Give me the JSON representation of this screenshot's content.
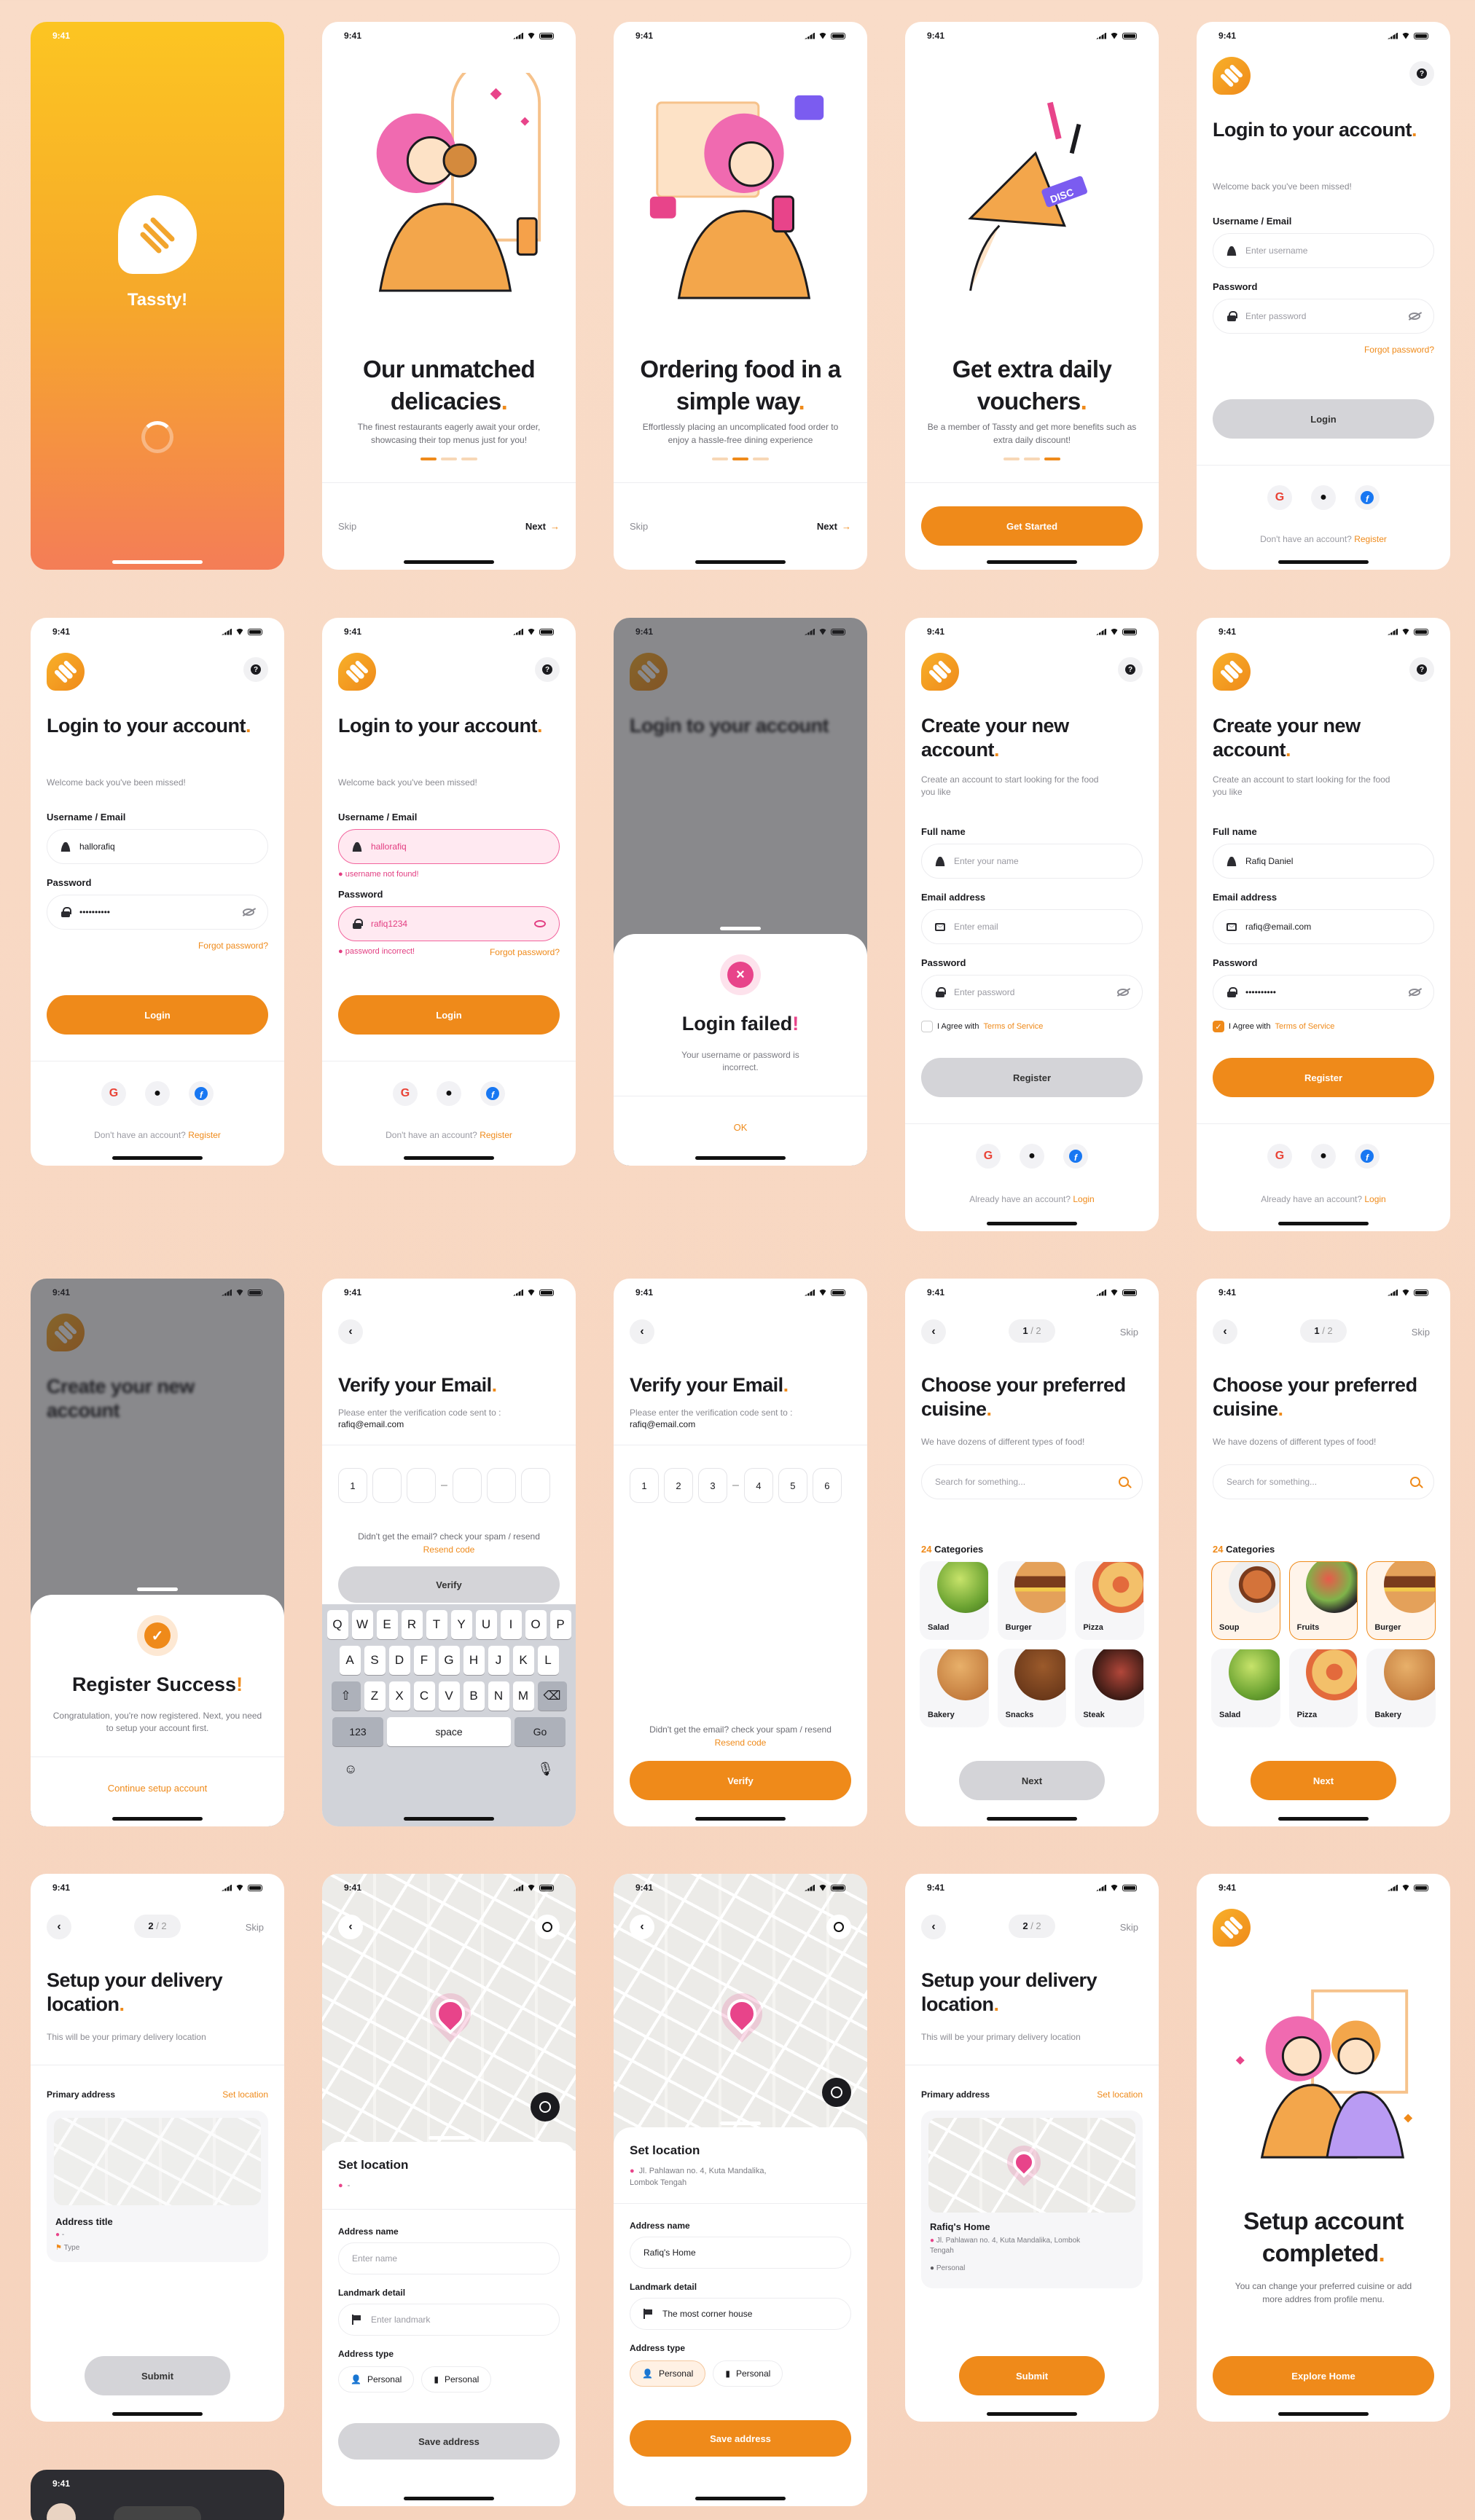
{
  "status_time": "9:41",
  "app_name": "Tassty!",
  "onboarding": [
    {
      "title": "Our unmatched delicacies",
      "desc": "The finest restaurants eagerly await your order, showcasing their top menus just for you!",
      "active": 0,
      "skip": "Skip",
      "next": "Next"
    },
    {
      "title": "Ordering food in a simple way",
      "desc": "Effortlessly placing an uncomplicated food order to enjoy a hassle-free dining experience",
      "active": 1,
      "skip": "Skip",
      "next": "Next"
    },
    {
      "title": "Get extra daily vouchers",
      "desc": "Be a member of Tassty and get more benefits such as extra daily discount!",
      "active": 2,
      "cta": "Get Started",
      "disc_label": "DISC"
    }
  ],
  "login": {
    "title": "Login to your account",
    "subtitle": "Welcome back you've been missed!",
    "username_label": "Username / Email",
    "username_placeholder": "Enter username",
    "password_label": "Password",
    "password_placeholder": "Enter password",
    "forgot": "Forgot password?",
    "button": "Login",
    "no_account": "Don't have an account?",
    "register_link": "Register",
    "filled_username": "hallorafiq",
    "filled_password": "••••••••••",
    "error_password_value": "rafiq1234",
    "error_username": "username not found!",
    "error_password": "password incorrect!"
  },
  "login_failed": {
    "title": "Login failed",
    "message": "Your username or password is incorrect.",
    "ok": "OK"
  },
  "register": {
    "title": "Create your new account",
    "subtitle": "Create an account to start looking for the food you like",
    "fullname_label": "Full name",
    "fullname_placeholder": "Enter your name",
    "fullname_value": "Rafiq Daniel",
    "email_label": "Email address",
    "email_placeholder": "Enter email",
    "email_value": "rafiq@email.com",
    "password_label": "Password",
    "password_placeholder": "Enter password",
    "password_value": "••••••••••",
    "agree": "I Agree with",
    "tos": "Terms of Service",
    "button": "Register",
    "have_account": "Already have an account?",
    "login_link": "Login"
  },
  "register_success": {
    "title": "Register Success",
    "message": "Congratulation, you're now registered. Next, you need to setup your account first.",
    "cta": "Continue setup account"
  },
  "verify": {
    "title": "Verify your Email",
    "subtitle": "Please enter the verification code sent to :",
    "email": "rafiq@email.com",
    "code_partial": [
      "1",
      "",
      "",
      "",
      "",
      ""
    ],
    "code_full": [
      "1",
      "2",
      "3",
      "4",
      "5",
      "6"
    ],
    "resend_text": "Didn't get the email? check your spam / resend",
    "resend_link": "Resend code",
    "button": "Verify"
  },
  "keyboard": {
    "row1": [
      "Q",
      "W",
      "E",
      "R",
      "T",
      "Y",
      "U",
      "I",
      "O",
      "P"
    ],
    "row2": [
      "A",
      "S",
      "D",
      "F",
      "G",
      "H",
      "J",
      "K",
      "L"
    ],
    "row3": [
      "Z",
      "X",
      "C",
      "V",
      "B",
      "N",
      "M"
    ],
    "num": "123",
    "space": "space",
    "go": "Go"
  },
  "cuisine": {
    "step": "1",
    "step_total": "/ 2",
    "skip": "Skip",
    "title": "Choose your preferred cuisine",
    "subtitle": "We have dozens of different types of food!",
    "search_placeholder": "Search for something...",
    "count": "24",
    "categories_label": "Categories",
    "items_a": [
      "Salad",
      "Burger",
      "Pizza",
      "Bakery",
      "Snacks",
      "Steak"
    ],
    "items_b": [
      "Soup",
      "Fruits",
      "Burger",
      "Salad",
      "Pizza",
      "Bakery"
    ],
    "button": "Next"
  },
  "location": {
    "step": "2",
    "step_total": "/ 2",
    "skip": "Skip",
    "title": "Setup your delivery location",
    "subtitle": "This will be your primary delivery location",
    "primary": "Primary address",
    "set_location": "Set location",
    "address_title": "Address title",
    "dash": "-",
    "type": "Type",
    "submit": "Submit",
    "sheet_title": "Set location",
    "address_full": "Jl. Pahlawan no. 4, Kuta Mandalika, Lombok Tengah",
    "address_name_label": "Address name",
    "address_name_placeholder": "Enter name",
    "address_name_value": "Rafiq's Home",
    "landmark_label": "Landmark detail",
    "landmark_placeholder": "Enter landmark",
    "landmark_value": "The most corner house",
    "type_label": "Address type",
    "type_options": [
      "Personal",
      "Personal"
    ],
    "save": "Save address",
    "saved_type": "Personal"
  },
  "complete": {
    "title": "Setup account completed",
    "desc": "You can change your preferred cuisine or add more addres from profile menu.",
    "cta": "Explore Home"
  },
  "colors": {
    "primary": "#EF8A1A",
    "accent_pink": "#E8448A",
    "background": "#F8D9C4"
  }
}
